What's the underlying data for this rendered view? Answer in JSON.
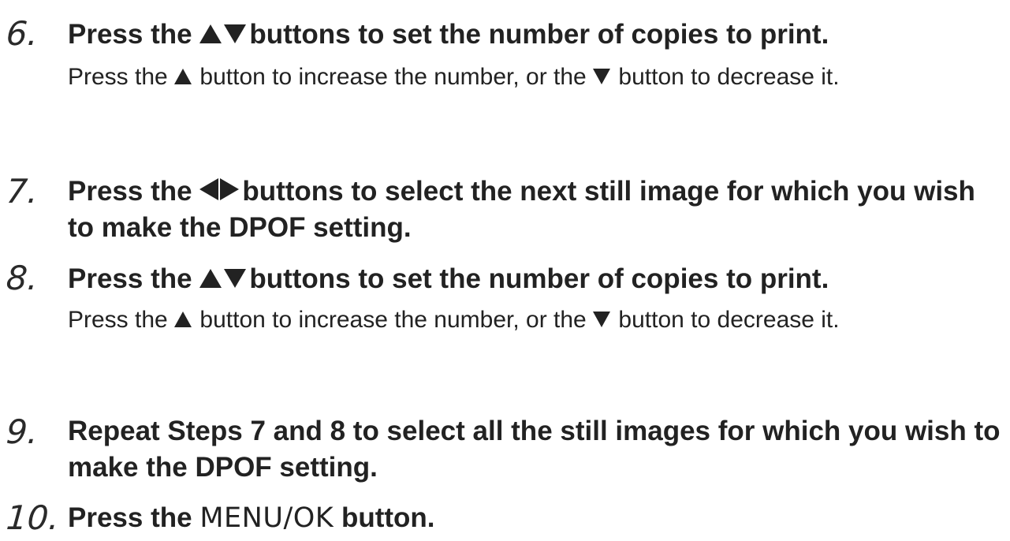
{
  "steps": [
    {
      "number": "6.",
      "heading_before": "Press the",
      "heading_after": "buttons to set the number of copies to print.",
      "body_1": "Press the",
      "body_2": "button to increase the number, or the",
      "body_3": "button to decrease it."
    },
    {
      "number": "7.",
      "heading_before": "Press the",
      "heading_after": "buttons to select the next still image for which you wish to make the DPOF setting."
    },
    {
      "number": "8.",
      "heading_before": "Press the",
      "heading_after": "buttons to set the number of copies to print.",
      "body_1": "Press the",
      "body_2": "button to increase the number, or the",
      "body_3": "button to decrease it."
    },
    {
      "number": "9.",
      "heading": "Repeat Steps 7 and 8 to select all the still images for which you wish to make the DPOF setting."
    },
    {
      "number": "10.",
      "heading_before": "Press the",
      "menu_label": "MENU/OK",
      "heading_after": "button."
    }
  ],
  "icons": {
    "up": "up-triangle-icon",
    "down": "down-triangle-icon",
    "left": "left-triangle-icon",
    "right": "right-triangle-icon"
  }
}
